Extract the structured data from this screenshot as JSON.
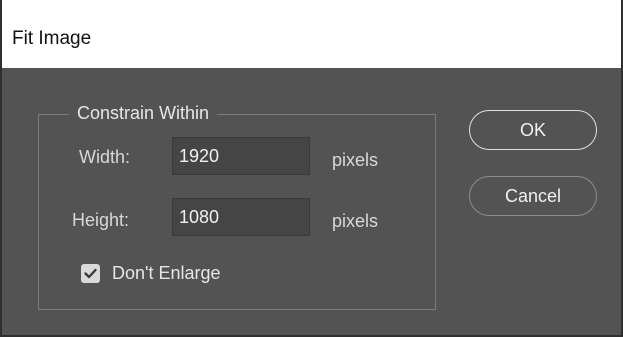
{
  "window": {
    "title": "Fit Image"
  },
  "constrain": {
    "legend": "Constrain Within",
    "width": {
      "label": "Width:",
      "value": "1920",
      "unit": "pixels"
    },
    "height": {
      "label": "Height:",
      "value": "1080",
      "unit": "pixels"
    },
    "dont_enlarge": {
      "label": "Don't Enlarge",
      "checked": true
    }
  },
  "buttons": {
    "ok": "OK",
    "cancel": "Cancel"
  },
  "colors": {
    "panel": "#535353",
    "field": "#454545",
    "text": "#e6e6e6"
  }
}
